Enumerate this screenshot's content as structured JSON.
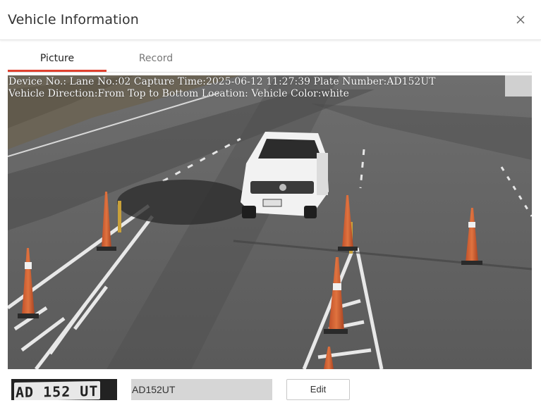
{
  "dialog": {
    "title": "Vehicle Information",
    "close_icon": "close-icon"
  },
  "tabs": [
    {
      "label": "Picture",
      "active": true
    },
    {
      "label": "Record",
      "active": false
    }
  ],
  "capture": {
    "osd_line1": "Device No.: Lane No.:02 Capture Time:2025-06-12  11:27:39 Plate Number:AD152UT",
    "osd_line2": "Vehicle Direction:From Top to Bottom Location: Vehicle Color:white"
  },
  "plate": {
    "thumb_text": "AD 152 UT",
    "value": "AD152UT",
    "edit_label": "Edit"
  },
  "colors": {
    "accent": "#e0412f",
    "field_bg": "#d6d6d6"
  }
}
